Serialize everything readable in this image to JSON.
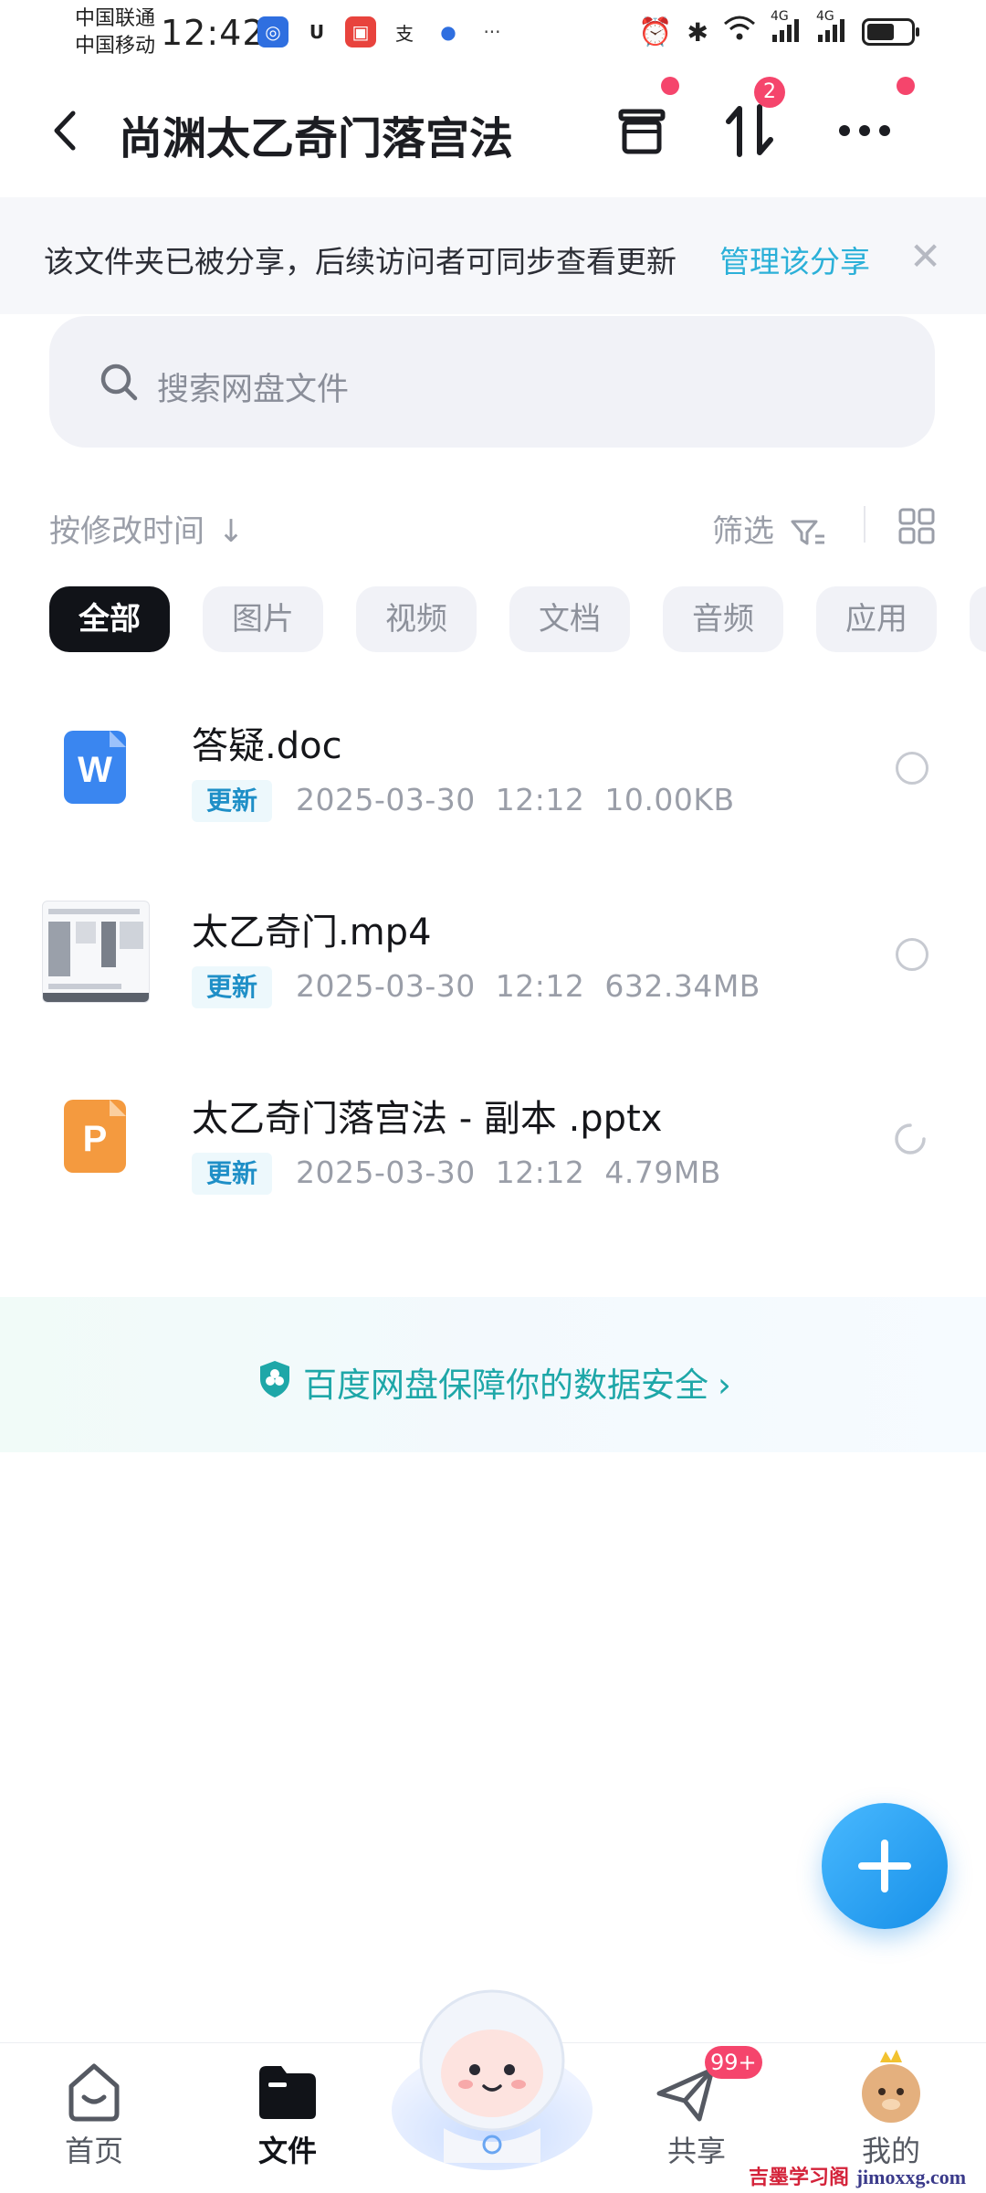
{
  "status_bar": {
    "carrier1": "中国联通",
    "carrier2": "中国移动",
    "time": "12:42",
    "net1": "4G",
    "net2": "4G"
  },
  "header": {
    "title": "尚渊太乙奇门落宫法",
    "transfer_badge": "2"
  },
  "share_banner": {
    "text": "该文件夹已被分享，后续访问者可同步查看更新",
    "link": "管理该分享"
  },
  "search": {
    "placeholder": "搜索网盘文件"
  },
  "sort": {
    "label": "按修改时间",
    "filter_label": "筛选"
  },
  "chips": [
    "全部",
    "图片",
    "视频",
    "文档",
    "音频",
    "应用"
  ],
  "files": [
    {
      "name": "答疑.doc",
      "tag": "更新",
      "date": "2025-03-30",
      "time": "12:12",
      "size": "10.00KB",
      "type": "word-icon"
    },
    {
      "name": "太乙奇门.mp4",
      "tag": "更新",
      "date": "2025-03-30",
      "time": "12:12",
      "size": "632.34MB",
      "type": "video-thumbnail"
    },
    {
      "name": "太乙奇门落宫法 - 副本 .pptx",
      "tag": "更新",
      "date": "2025-03-30",
      "time": "12:12",
      "size": "4.79MB",
      "type": "ppt-icon"
    }
  ],
  "security_banner": {
    "text": "百度网盘保障你的数据安全"
  },
  "nav": {
    "home": "首页",
    "files": "文件",
    "share": "共享",
    "share_badge": "99+",
    "me": "我的"
  },
  "watermark": {
    "text": "吉墨学习阁",
    "url": "jimoxxg.com"
  },
  "colors": {
    "accent": "#2bb0d8",
    "badge": "#f5456c",
    "fab": "#1e9bf0"
  }
}
